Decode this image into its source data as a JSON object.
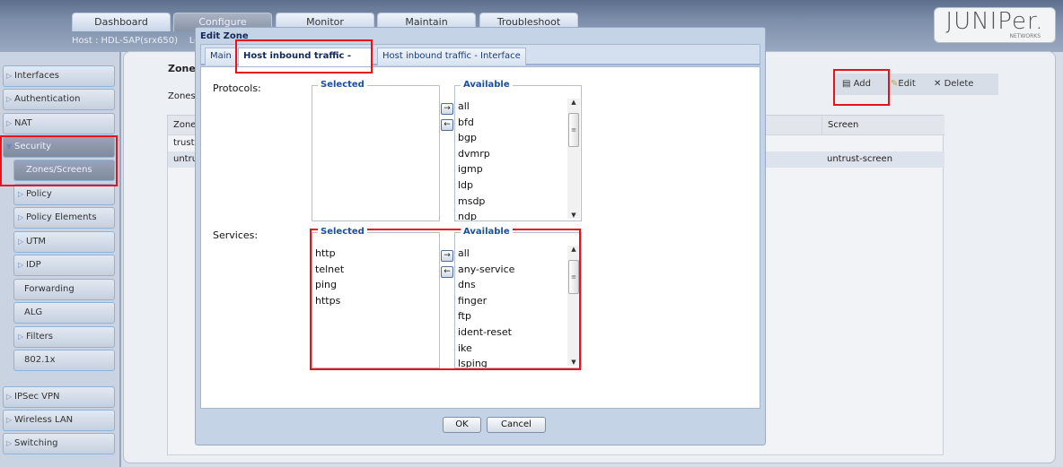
{
  "header": {
    "tabs": [
      {
        "label": "Dashboard",
        "active": false
      },
      {
        "label": "Configure",
        "active": true
      },
      {
        "label": "Monitor",
        "active": false
      },
      {
        "label": "Maintain",
        "active": false
      },
      {
        "label": "Troubleshoot",
        "active": false
      }
    ],
    "host": "Host : HDL-SAP(srx650)",
    "host_trail": "Lo",
    "logo": {
      "text": "JUNIPer.",
      "sub": "NETWORKS"
    }
  },
  "sidebar": {
    "items": [
      {
        "label": "Interfaces",
        "expandable": true
      },
      {
        "label": "Authentication",
        "expandable": true
      },
      {
        "label": "NAT",
        "expandable": true
      },
      {
        "label": "Security",
        "expanded": true
      },
      {
        "label": "Zones/Screens",
        "selected": true
      },
      {
        "label": "Policy",
        "expandable": true
      },
      {
        "label": "Policy Elements",
        "expandable": true
      },
      {
        "label": "UTM",
        "expandable": true
      },
      {
        "label": "IDP",
        "expandable": true
      },
      {
        "label": "Forwarding"
      },
      {
        "label": "ALG"
      },
      {
        "label": "Filters",
        "expandable": true
      },
      {
        "label": "802.1x"
      },
      {
        "label": "IPSec VPN",
        "expandable": true
      },
      {
        "label": "Wireless LAN",
        "expandable": true
      },
      {
        "label": "Switching",
        "expandable": true
      }
    ]
  },
  "main": {
    "title": "Zones",
    "subtitle": "Zones l",
    "toolbar": {
      "add": "Add",
      "edit": "Edit",
      "delete": "Delete"
    },
    "grid": {
      "columns": [
        "Zone",
        "Screen"
      ],
      "rows": [
        {
          "zone": "trust",
          "screen": ""
        },
        {
          "zone": "untru",
          "screen": "untrust-screen"
        }
      ]
    }
  },
  "dialog": {
    "title": "Edit Zone",
    "tabs": [
      {
        "label": "Main",
        "active": false
      },
      {
        "label": "Host inbound traffic - Zone",
        "active": true
      },
      {
        "label": "Host inbound traffic - Interface",
        "active": false
      }
    ],
    "protocols": {
      "label": "Protocols:",
      "selected_title": "Selected",
      "available_title": "Available",
      "selected": [],
      "available": [
        "all",
        "bfd",
        "bgp",
        "dvmrp",
        "igmp",
        "ldp",
        "msdp",
        "ndp"
      ]
    },
    "services": {
      "label": "Services:",
      "selected_title": "Selected",
      "available_title": "Available",
      "selected": [
        "http",
        "telnet",
        "ping",
        "https"
      ],
      "available": [
        "all",
        "any-service",
        "dns",
        "finger",
        "ftp",
        "ident-reset",
        "ike",
        "lsping"
      ]
    },
    "buttons": {
      "ok": "OK",
      "cancel": "Cancel"
    }
  },
  "colors": {
    "highlight": "#e8121b",
    "legend": "#1a4fa3"
  }
}
